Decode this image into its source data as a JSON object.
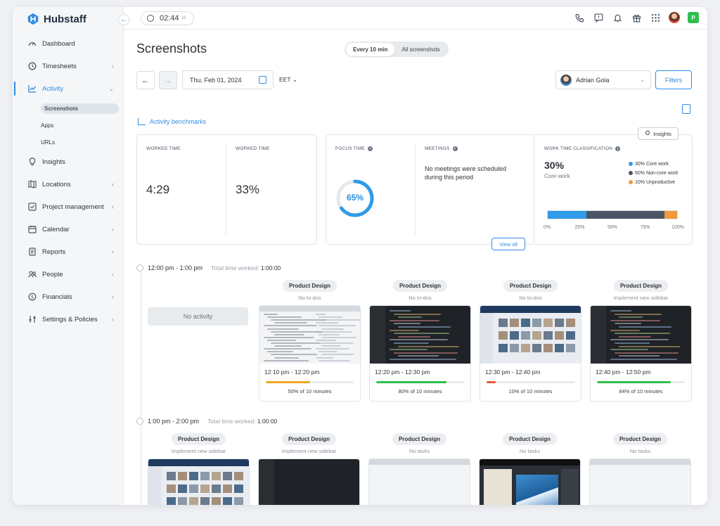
{
  "app": {
    "name": "Hubstaff"
  },
  "sidebar": {
    "items": [
      {
        "label": "Dashboard",
        "icon": "dashboard-icon",
        "chevron": false
      },
      {
        "label": "Timesheets",
        "icon": "clock-icon",
        "chevron": true
      },
      {
        "label": "Activity",
        "icon": "chart-icon",
        "chevron": true,
        "active": true
      },
      {
        "label": "Insights",
        "icon": "lightbulb-icon",
        "chevron": false
      },
      {
        "label": "Locations",
        "icon": "map-icon",
        "chevron": true
      },
      {
        "label": "Project management",
        "icon": "checkbox-icon",
        "chevron": true
      },
      {
        "label": "Calendar",
        "icon": "calendar-icon",
        "chevron": true
      },
      {
        "label": "Reports",
        "icon": "report-icon",
        "chevron": true
      },
      {
        "label": "People",
        "icon": "people-icon",
        "chevron": true
      },
      {
        "label": "Financials",
        "icon": "dollar-icon",
        "chevron": true
      },
      {
        "label": "Settings & Policies",
        "icon": "sliders-icon",
        "chevron": true
      }
    ],
    "activity_sub": [
      "Screenshots",
      "Apps",
      "URLs"
    ]
  },
  "topbar": {
    "timer": "02:44",
    "timer_seconds": "18",
    "profile_initial": "P"
  },
  "page": {
    "title": "Screenshots",
    "toggle": [
      "Every 10 min",
      "All screenshots"
    ],
    "date": "Thu, Feb 01, 2024",
    "timezone": "EET",
    "user": "Adrian Goia",
    "filters": "Filters",
    "benchmarks": "Activity benchmarks"
  },
  "stats": {
    "worked_time_label": "WORKED TIME",
    "worked_time_value": "4:29",
    "worked_pct_label": "WORKED TIME",
    "worked_pct_value": "33%",
    "focus_label": "FOCUS TIME",
    "focus_value": "65%",
    "focus_fraction": 0.65,
    "meetings_label": "MEETINGS",
    "meetings_text": "No meetings were scheduled during this period",
    "view_all": "View all",
    "insights": "Insights",
    "classification_label": "WORK TIME CLASSIFICATION",
    "core_value": "30%",
    "core_label": "Core work",
    "legend": [
      {
        "text": "30% Core work",
        "color": "#2f9be9",
        "pct": 30
      },
      {
        "text": "60% Non-core work",
        "color": "#4b5563",
        "pct": 60
      },
      {
        "text": "10% Unproductive",
        "color": "#f29a3c",
        "pct": 10
      }
    ],
    "ticks": [
      "0%",
      "25%",
      "50%",
      "75%",
      "100%"
    ]
  },
  "slots": [
    {
      "range": "12:00  pm - 1:00 pm",
      "total_label": "Total time worked:",
      "total_value": "1:00:00",
      "no_activity": "No activity",
      "tiles": [
        {
          "project": "Product Design",
          "todo": "No to-dos",
          "time": "12:10 pm - 12:20 pm",
          "activity": "50% of 10 minutes",
          "pct": 50,
          "color": "#f2a623",
          "theme": "light"
        },
        {
          "project": "Product Design",
          "todo": "No to-dos",
          "time": "12:20 pm - 12:30 pm",
          "activity": "80% of 10 minutes",
          "pct": 80,
          "color": "#2fbf4f",
          "theme": "dark"
        },
        {
          "project": "Product Design",
          "todo": "No to-dos",
          "time": "12:30 pm - 12:40 pm",
          "activity": "10% of 10 minutes",
          "pct": 10,
          "color": "#e8553a",
          "theme": "web"
        },
        {
          "project": "Product Design",
          "todo": "Implement new sidebar",
          "time": "12:40 pm - 12:50 pm",
          "activity": "84% of 10 minutes",
          "pct": 84,
          "color": "#2fbf4f",
          "theme": "dark"
        }
      ]
    },
    {
      "range": "1:00  pm - 2:00 pm",
      "total_label": "Total time worked:",
      "total_value": "1:00:00",
      "tiles": [
        {
          "project": "Product Design",
          "todo": "Implement new sidebar",
          "theme": "web"
        },
        {
          "project": "Product Design",
          "todo": "Implement new sidebar",
          "theme": "dark"
        },
        {
          "project": "Product Design",
          "todo": "No tasks",
          "theme": "light"
        },
        {
          "project": "Product Design",
          "todo": "No tasks",
          "theme": "photo"
        },
        {
          "project": "Product Design",
          "todo": "No tasks",
          "theme": "light"
        }
      ]
    }
  ]
}
